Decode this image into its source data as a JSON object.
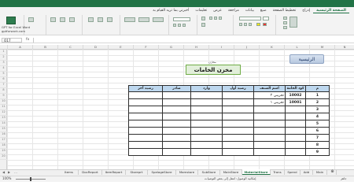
{
  "ribbon_tabs": [
    "الصفحة الرئيسية",
    "إدراج",
    "تخطيط الصفحة",
    "صيغ",
    "بيانات",
    "مراجعة",
    "عرض",
    "تعليمات",
    "أخبرني بما تريد القيام به"
  ],
  "ribbon_addin": {
    "label": "GPT for Excel Word",
    "site": "gptforwork.com"
  },
  "name_box": "O17",
  "fx": "fx",
  "columns": [
    "A",
    "B",
    "C",
    "D",
    "E",
    "F",
    "G",
    "H",
    "I",
    "J",
    "K",
    "L",
    "M",
    "N"
  ],
  "rows": [
    "1",
    "2",
    "3",
    "4",
    "5",
    "6",
    "7",
    "8",
    "9",
    "10",
    "11",
    "12",
    "13",
    "14",
    "15",
    "16",
    "17",
    "18",
    "19",
    "20"
  ],
  "home_button": "الرئيسية",
  "subtitle": "مخازن",
  "title": "مخزن الخامات",
  "table": {
    "headers": [
      "م",
      "كود الخامة",
      "اسم الصنف",
      "رصيد أول",
      "وارد",
      "صادر",
      "رصيد آخر"
    ],
    "rows": [
      {
        "n": "1",
        "code": "10002",
        "name": "تجريبي ٢"
      },
      {
        "n": "2",
        "code": "10001",
        "name": "تجريبي ١"
      },
      {
        "n": "3",
        "code": "",
        "name": ""
      },
      {
        "n": "4",
        "code": "",
        "name": ""
      },
      {
        "n": "5",
        "code": "",
        "name": ""
      },
      {
        "n": "6",
        "code": "",
        "name": ""
      },
      {
        "n": "7",
        "code": "",
        "name": ""
      },
      {
        "n": "8",
        "code": "",
        "name": ""
      },
      {
        "n": "9",
        "code": "",
        "name": ""
      }
    ]
  },
  "sheet_tabs": [
    "Items",
    "DocReport",
    "ItemReport",
    "Storeprt",
    "SpelageStore",
    "Mamstore",
    "SubStore",
    "MainStore",
    "MaterialStore",
    "Trans",
    "Spend",
    "Add",
    "Main"
  ],
  "active_sheet": "MaterialStore",
  "status": {
    "zoom": "100%",
    "ready": "جاهز",
    "message": "إمكانية الوصول: انتقل إلى بعض التوصيات"
  }
}
